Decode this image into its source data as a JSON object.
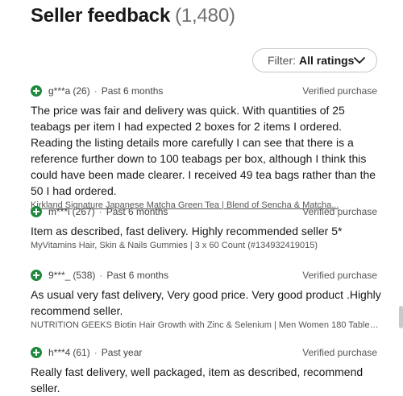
{
  "header": {
    "title": "Seller feedback",
    "count": "(1,480)"
  },
  "filter": {
    "label": "Filter:",
    "value": "All ratings"
  },
  "reviews": [
    {
      "user": "g***a",
      "score": "(26)",
      "time": "Past 6 months",
      "verified": "Verified purchase",
      "text": "The price was fair and delivery was quick. With quantities of 25 teabags per item I had expected 2 boxes for 2 items I ordered. Reading the listing details more carefully I can see that there is a reference further down to 100 teabags per box, although I think this could have been made clearer. I received 49 tea bags rather than the 50 I had ordered.",
      "item": "Kirkland Signature Japanese Matcha Green Tea | Blend of Sencha & Matcha..."
    },
    {
      "user": "m***i",
      "score": "(267)",
      "time": "Past 6 months",
      "verified": "Verified purchase",
      "text": "Item as described, fast delivery. Highly recommended seller 5*",
      "item": "MyVitamins Hair, Skin & Nails Gummies | 3 x 60 Count (#134932419015)"
    },
    {
      "user": "9***_",
      "score": "(538)",
      "time": "Past 6 months",
      "verified": "Verified purchase",
      "text": "As usual very fast delivery, Very good price. Very good product .Highly recommend seller.",
      "item": "NUTRITION GEEKS Biotin Hair Growth with Zinc & Selenium | Men Women 180 Tablet..."
    },
    {
      "user": "h***4",
      "score": "(61)",
      "time": "Past year",
      "verified": "Verified purchase",
      "text": "Really fast delivery, well packaged, item as described, recommend seller.",
      "item": ""
    }
  ],
  "icons": {
    "positive": "plus-circle-icon",
    "filter_chevron": "chevron-down-icon"
  },
  "colors": {
    "positive": "#1f8a3d",
    "text": "#191919",
    "muted": "#707070"
  }
}
